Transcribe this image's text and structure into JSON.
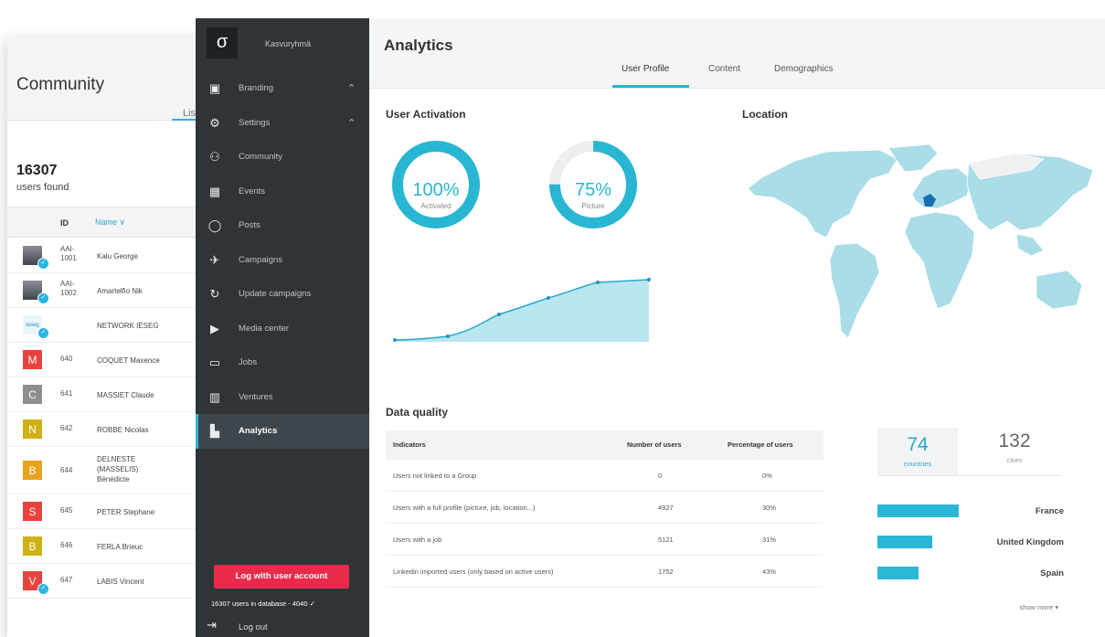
{
  "community": {
    "title": "Community",
    "tab_fragment": "Lis",
    "user_count": "16307",
    "users_found": "users found",
    "columns": {
      "id": "ID",
      "name": "Name ∨"
    },
    "rows": [
      {
        "id": "AAI-\n1001",
        "name": "Kalu George",
        "avatar": "photo",
        "verified": true
      },
      {
        "id": "AAI-\n1002",
        "name": "Amartelfio Nik",
        "avatar": "photo",
        "verified": true
      },
      {
        "id": "",
        "name": "NETWORK IÉSEG",
        "avatar": "logo",
        "avatar_text": "ieseg",
        "verified": true
      },
      {
        "id": "640",
        "name": "COQUET Maxence",
        "avatar_letter": "M",
        "avatar_color": "#e8423f"
      },
      {
        "id": "641",
        "name": "MASSIET Claude",
        "avatar_letter": "C",
        "avatar_color": "#8e8e8e"
      },
      {
        "id": "642",
        "name": "ROBBE Nicolas",
        "avatar_letter": "N",
        "avatar_color": "#cfb114"
      },
      {
        "id": "644",
        "name": "DELNESTE\n(MASSELIS)\nBénédicte",
        "avatar_letter": "B",
        "avatar_color": "#e8a21e",
        "tall": true
      },
      {
        "id": "645",
        "name": "PETER Stephane",
        "avatar_letter": "S",
        "avatar_color": "#e8423f"
      },
      {
        "id": "646",
        "name": "FERLA Brieuc",
        "avatar_letter": "B",
        "avatar_color": "#cfb114"
      },
      {
        "id": "647",
        "name": "LABIS Vincent",
        "avatar_letter": "V",
        "avatar_color": "#e8423f",
        "verified": true
      }
    ]
  },
  "sidebar": {
    "logo_glyph": "σ",
    "org_name": "Kasvuryhmä",
    "items": [
      {
        "label": "Branding",
        "icon": "image-icon",
        "glyph": "▣",
        "chevron": "⌃"
      },
      {
        "label": "Settings",
        "icon": "gear-icon",
        "glyph": "⚙",
        "chevron": "⌃"
      },
      {
        "label": "Community",
        "icon": "users-icon",
        "glyph": "⚇"
      },
      {
        "label": "Events",
        "icon": "calendar-icon",
        "glyph": "▦"
      },
      {
        "label": "Posts",
        "icon": "speech-bubble-icon",
        "glyph": "◯"
      },
      {
        "label": "Campaigns",
        "icon": "paper-plane-icon",
        "glyph": "✈"
      },
      {
        "label": "Update campaigns",
        "icon": "refresh-icon",
        "glyph": "↻"
      },
      {
        "label": "Media center",
        "icon": "play-circle-icon",
        "glyph": "▶"
      },
      {
        "label": "Jobs",
        "icon": "briefcase-icon",
        "glyph": "▭"
      },
      {
        "label": "Ventures",
        "icon": "building-icon",
        "glyph": "▥"
      },
      {
        "label": "Analytics",
        "icon": "bar-chart-icon",
        "glyph": "▙",
        "active": true
      }
    ],
    "log_button": "Log with user account",
    "db_info": "16307 users in database - 4040 ✓",
    "logout_label": "Log out",
    "logout_glyph": "⇥"
  },
  "analytics": {
    "title": "Analytics",
    "tabs": [
      "User Profile",
      "Content",
      "Demographics"
    ],
    "active_tab": "User Profile",
    "user_activation_title": "User Activation",
    "location_title": "Location",
    "donuts": [
      {
        "value": "100%",
        "caption": "Activated",
        "fraction": 1.0
      },
      {
        "value": "75%",
        "caption": "Picture",
        "fraction": 0.75
      }
    ],
    "accent_color": "#29b6d2",
    "data_quality_title": "Data quality",
    "table_headers": [
      "Indicators",
      "Number of users",
      "Percentage of users"
    ],
    "table_rows": [
      [
        "Users not linked to a Group",
        "0",
        "0%"
      ],
      [
        "Users with a full profile (picture, job, location...)",
        "4927",
        "30%"
      ],
      [
        "Users with a job",
        "5121",
        "31%"
      ],
      [
        "Linkedin imported users (only based on active users)",
        "1752",
        "43%"
      ]
    ],
    "countries_count": "74",
    "countries_label": "countries",
    "cities_count": "132",
    "cities_label": "cities",
    "country_bars": [
      {
        "name": "France",
        "fraction": 0.43
      },
      {
        "name": "United Kingdom",
        "fraction": 0.29
      },
      {
        "name": "Spain",
        "fraction": 0.22
      }
    ],
    "show_more": "show more ▾"
  }
}
